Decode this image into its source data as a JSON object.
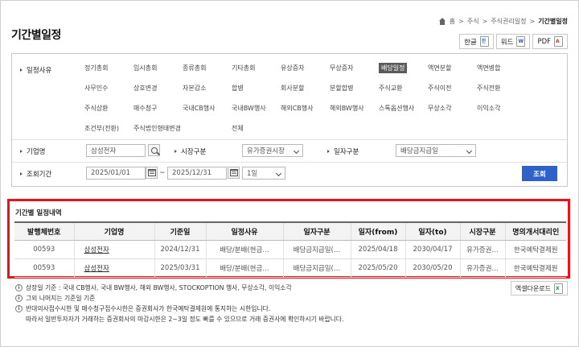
{
  "breadcrumb": {
    "items": [
      "홈",
      "주식",
      "주식권리일정",
      "기간별일정"
    ],
    "sep": ">"
  },
  "page_title": "기간별일정",
  "doc_buttons": [
    {
      "label": "한글",
      "icon": "hwp-icon",
      "glyph": "한"
    },
    {
      "label": "워드",
      "icon": "word-icon",
      "glyph": "W"
    },
    {
      "label": "PDF",
      "icon": "pdf-icon",
      "glyph": "A"
    }
  ],
  "search": {
    "schedule_label": "일정사유",
    "categories": [
      "정기총회",
      "임시총회",
      "종류총회",
      "기타총회",
      "유상증자",
      "무상증자",
      "배당일정",
      "액면분할",
      "액면병합",
      "사무인수",
      "상호변경",
      "자본감소",
      "합병",
      "회사분할",
      "분할합병",
      "주식교환",
      "주식이전",
      "주식전환",
      "주식상환",
      "매수청구",
      "국내CB행사",
      "국내BW행사",
      "해외CB행사",
      "해외BW행사",
      "스톡옵션행사",
      "무상소각",
      "이익소각",
      "조건부(전환)",
      "주식법인형태변경",
      "",
      "전체"
    ],
    "selected_category": "배당일정",
    "company_label": "기업명",
    "company_value": "삼성전자",
    "market_label": "시장구분",
    "market_value": "유가증권시장",
    "date_type_label": "일자구분",
    "date_type_value": "배당금지급일",
    "period_label": "조회기간",
    "date_from": "2025/01/01",
    "tilde": "~",
    "date_to": "2025/12/31",
    "period_option": "1일",
    "query_label": "조회"
  },
  "results": {
    "title": "기간별 일정내역",
    "columns": [
      "발행체번호",
      "기업명",
      "기준일",
      "일정사유",
      "일자구분",
      "일자(from)",
      "일자(to)",
      "시장구분",
      "명의개서대리인"
    ],
    "rows": [
      [
        "00593",
        "삼성전자",
        "2024/12/31",
        "배당/분배(현금…",
        "배당금지급일(…",
        "2025/04/18",
        "2030/04/17",
        "유가증권…",
        "한국예탁결제원"
      ],
      [
        "00593",
        "삼성전자",
        "2025/03/31",
        "배당/분배(현금…",
        "배당금지급일(…",
        "2025/05/20",
        "2030/05/20",
        "유가증권…",
        "한국예탁결제원"
      ]
    ]
  },
  "notes": [
    "상장일 기준 : 국내 CB행사, 국내 BW행사, 해외 BW행사, STOCKOPTION 행사, 무상소각, 이익소각",
    "그외 나머지는 기준일 기준",
    "반대의사접수시한 및 매수청구접수시한은 증권회사가 한국예탁결제원에 통지하는 시한입니다.",
    "따라서 일반투자자가 거래하는 증권회사의 마감시한은 2~3일 정도 빠를 수 있으므로 거래 증권사에 확인하시기 바랍니다."
  ],
  "excel_download": {
    "label": "엑셀다운로드",
    "icon": "excel-icon"
  },
  "colors": {
    "accent": "#2f62c8",
    "highlight": "#e8141b",
    "selected": "#5b5b5b"
  }
}
